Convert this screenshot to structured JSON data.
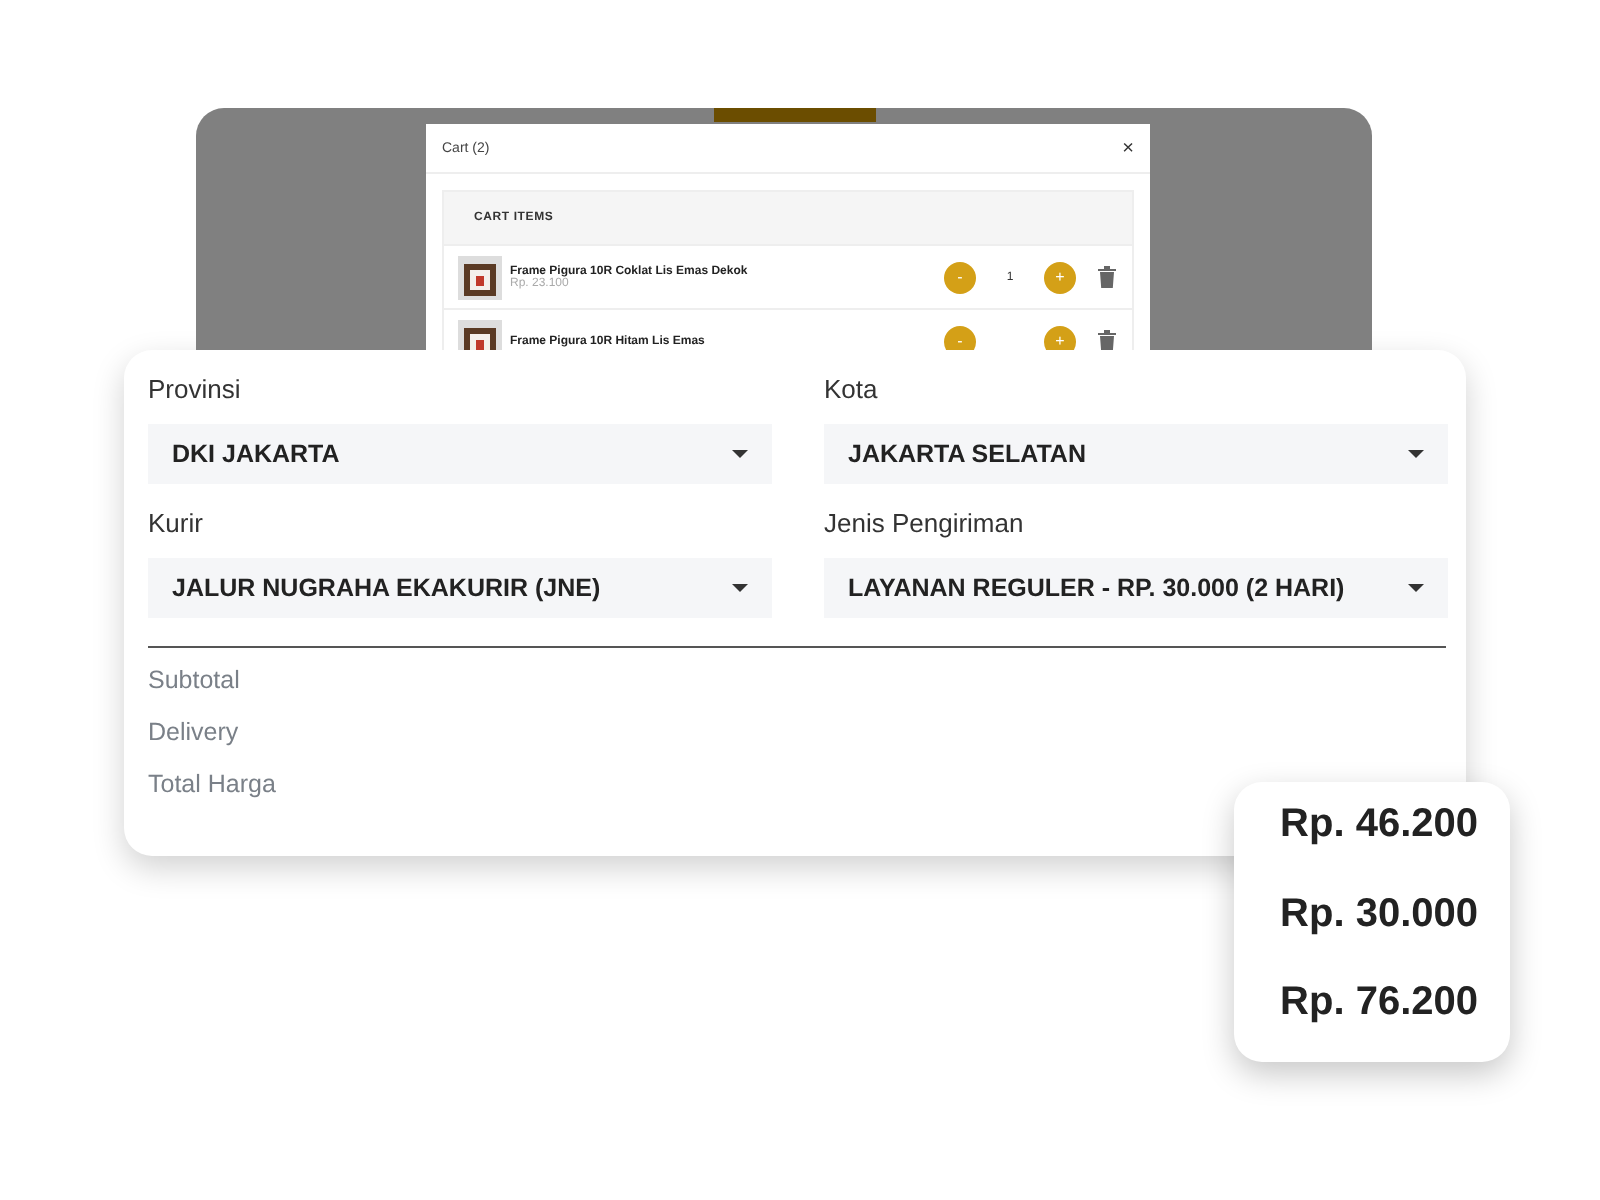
{
  "cart": {
    "title": "Cart (2)",
    "close": "×",
    "section": "CART ITEMS",
    "items": [
      {
        "name": "Frame Pigura 10R Coklat Lis Emas Dekok",
        "price": "Rp. 23.100",
        "quantity": "1",
        "minus": "-",
        "plus": "+"
      },
      {
        "name": "Frame Pigura 10R Hitam Lis Emas",
        "minus": "-",
        "plus": "+"
      }
    ]
  },
  "form": {
    "fields": [
      {
        "label": "Provinsi",
        "value": "DKI JAKARTA"
      },
      {
        "label": "Kota",
        "value": "JAKARTA SELATAN"
      },
      {
        "label": "Kurir",
        "value": "JALUR NUGRAHA EKAKURIR (JNE)"
      },
      {
        "label": "Jenis Pengiriman",
        "value": "LAYANAN REGULER - RP. 30.000 (2 HARI)"
      }
    ],
    "summary": [
      "Subtotal",
      "Delivery",
      "Total Harga"
    ]
  },
  "totals": [
    "Rp. 46.200",
    "Rp. 30.000",
    "Rp. 76.200"
  ]
}
